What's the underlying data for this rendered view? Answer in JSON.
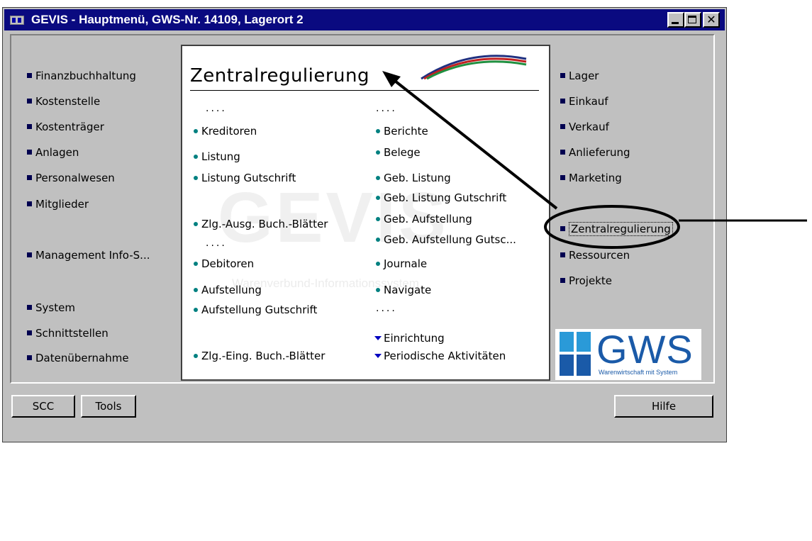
{
  "window": {
    "title": "GEVIS - Hauptmenü, GWS-Nr. 14109, Lagerort 2"
  },
  "left_nav": [
    {
      "label": "Finanzbuchhaltung"
    },
    {
      "label": "Kostenstelle"
    },
    {
      "label": "Kostenträger"
    },
    {
      "label": "Anlagen"
    },
    {
      "label": "Personalwesen"
    },
    {
      "label": "Mitglieder"
    },
    {
      "label": "Management Info-S..."
    },
    {
      "label": "System"
    },
    {
      "label": "Schnittstellen"
    },
    {
      "label": "Datenübernahme"
    }
  ],
  "right_nav": [
    {
      "label": "Lager"
    },
    {
      "label": "Einkauf"
    },
    {
      "label": "Verkauf"
    },
    {
      "label": "Anlieferung"
    },
    {
      "label": "Marketing"
    },
    {
      "label": "Zentralregulierung"
    },
    {
      "label": "Ressourcen"
    },
    {
      "label": "Projekte"
    }
  ],
  "panel": {
    "title": "Zentralregulierung",
    "dots": "....",
    "left_col": [
      "Kreditoren",
      "Listung",
      "Listung Gutschrift",
      "Zlg.-Ausg. Buch.-Blätter",
      "Debitoren",
      "Aufstellung",
      "Aufstellung Gutschrift",
      "Zlg.-Eing. Buch.-Blätter"
    ],
    "right_col": [
      "Berichte",
      "Belege",
      "Geb. Listung",
      "Geb. Listung Gutschrift",
      "Geb. Aufstellung",
      "Geb. Aufstellung Gutsc...",
      "Journale",
      "Navigate"
    ],
    "dropdowns": [
      "Einrichtung",
      "Periodische Aktivitäten"
    ],
    "watermark": "GEVIS",
    "watermark_sub": "Warenverbund-Informationssystem"
  },
  "logo": {
    "text": "GWS",
    "tagline": "Warenwirtschaft mit System",
    "color": "#1a5aa8"
  },
  "buttons": {
    "scc": "SCC",
    "tools": "Tools",
    "help": "Hilfe"
  },
  "colors": {
    "titlebar": "#0a0a80",
    "face": "#c0c0c0",
    "bullet": "#008080"
  }
}
